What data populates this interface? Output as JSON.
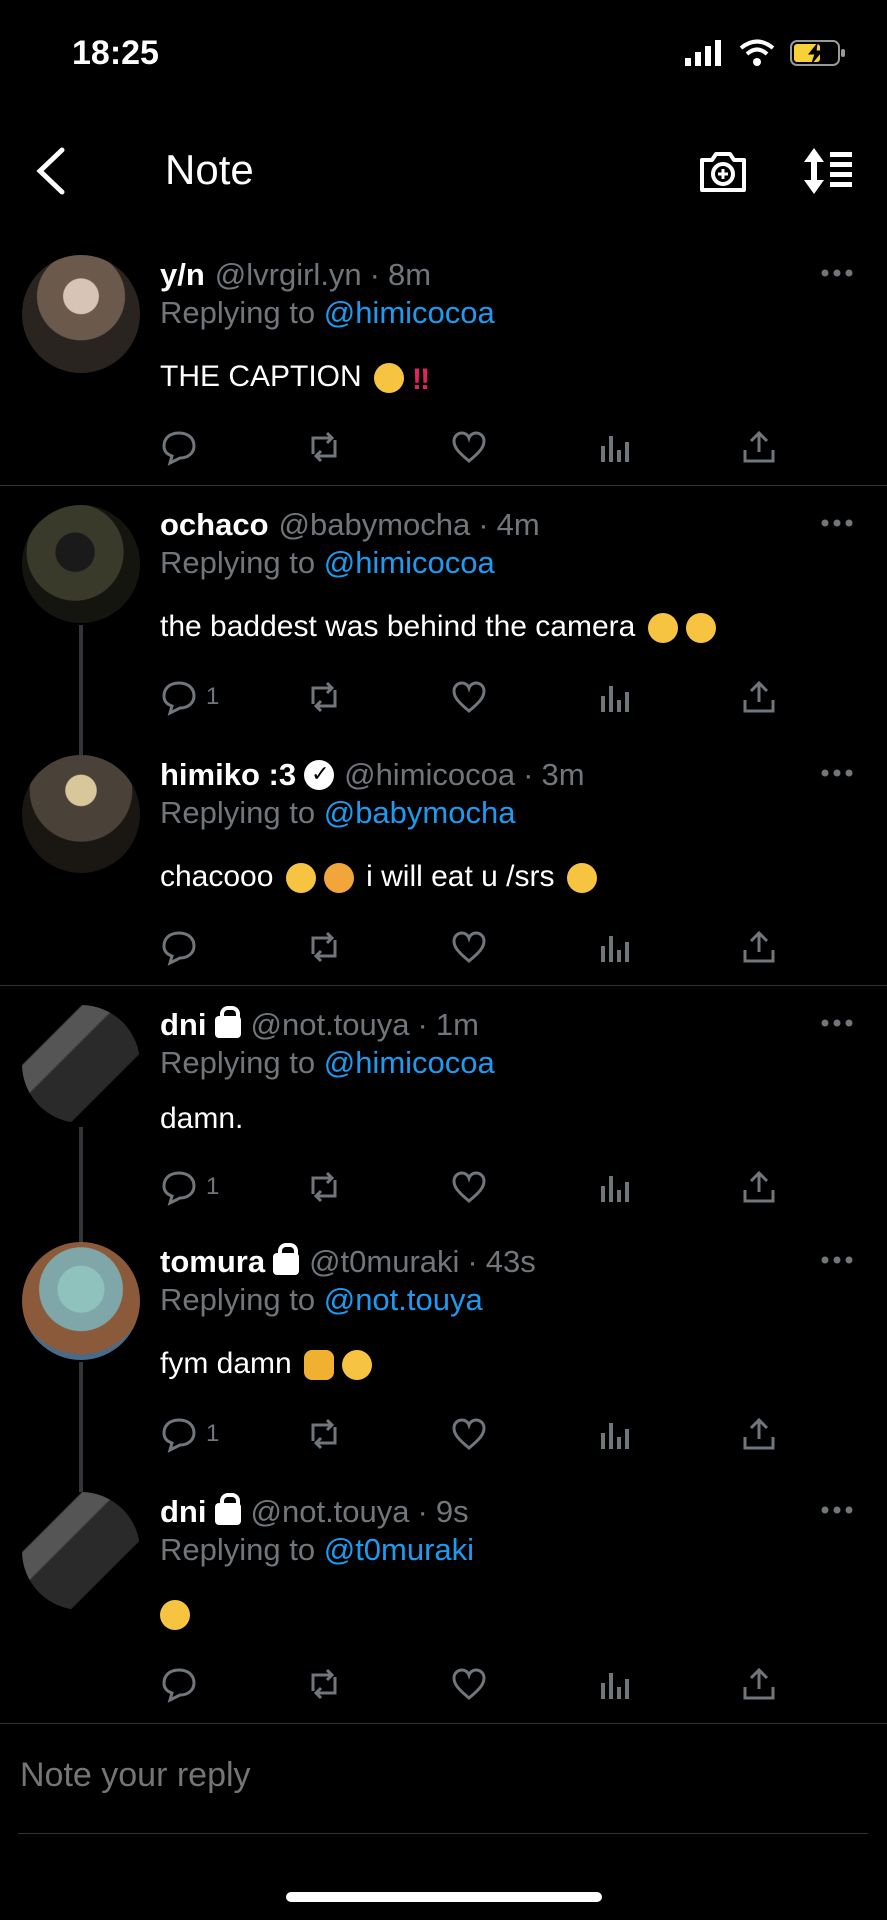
{
  "status": {
    "time": "18:25"
  },
  "header": {
    "title": "Note"
  },
  "tweets": [
    {
      "name": "y/n",
      "handle": "@lvrgirl.yn",
      "time": "8m",
      "replying_prefix": "Replying to",
      "replying_to": "@himicocoa",
      "text": "THE CAPTION",
      "reply_count": "",
      "badge": "none",
      "avatar_color": "#6b5a4c"
    },
    {
      "name": "ochaco",
      "handle": "@babymocha",
      "time": "4m",
      "replying_prefix": "Replying to",
      "replying_to": "@himicocoa",
      "text": "the baddest was behind the camera",
      "reply_count": "1",
      "badge": "none",
      "avatar_color": "#3a3a2a"
    },
    {
      "name": "himiko :3",
      "handle": "@himicocoa",
      "time": "3m",
      "replying_prefix": "Replying to",
      "replying_to": "@babymocha",
      "text": "chacooo",
      "text2": "i will eat u /srs",
      "reply_count": "",
      "badge": "verified",
      "avatar_color": "#4a4238"
    },
    {
      "name": "dni",
      "handle": "@not.touya",
      "time": "1m",
      "replying_prefix": "Replying to",
      "replying_to": "@himicocoa",
      "text": "damn.",
      "reply_count": "1",
      "badge": "lock",
      "avatar_color": "#2a2a2a"
    },
    {
      "name": "tomura",
      "handle": "@t0muraki",
      "time": "43s",
      "replying_prefix": "Replying to",
      "replying_to": "@not.touya",
      "text": "fym damn",
      "reply_count": "1",
      "badge": "lock",
      "avatar_color": "#7fa6a8"
    },
    {
      "name": "dni",
      "handle": "@not.touya",
      "time": "9s",
      "replying_prefix": "Replying to",
      "replying_to": "@t0muraki",
      "text": "",
      "reply_count": "",
      "badge": "lock",
      "avatar_color": "#2a2a2a"
    }
  ],
  "reply_box": {
    "placeholder": "Note your reply"
  },
  "colors": {
    "link": "#1d9bf0",
    "muted": "#71767b",
    "background": "#000000"
  }
}
